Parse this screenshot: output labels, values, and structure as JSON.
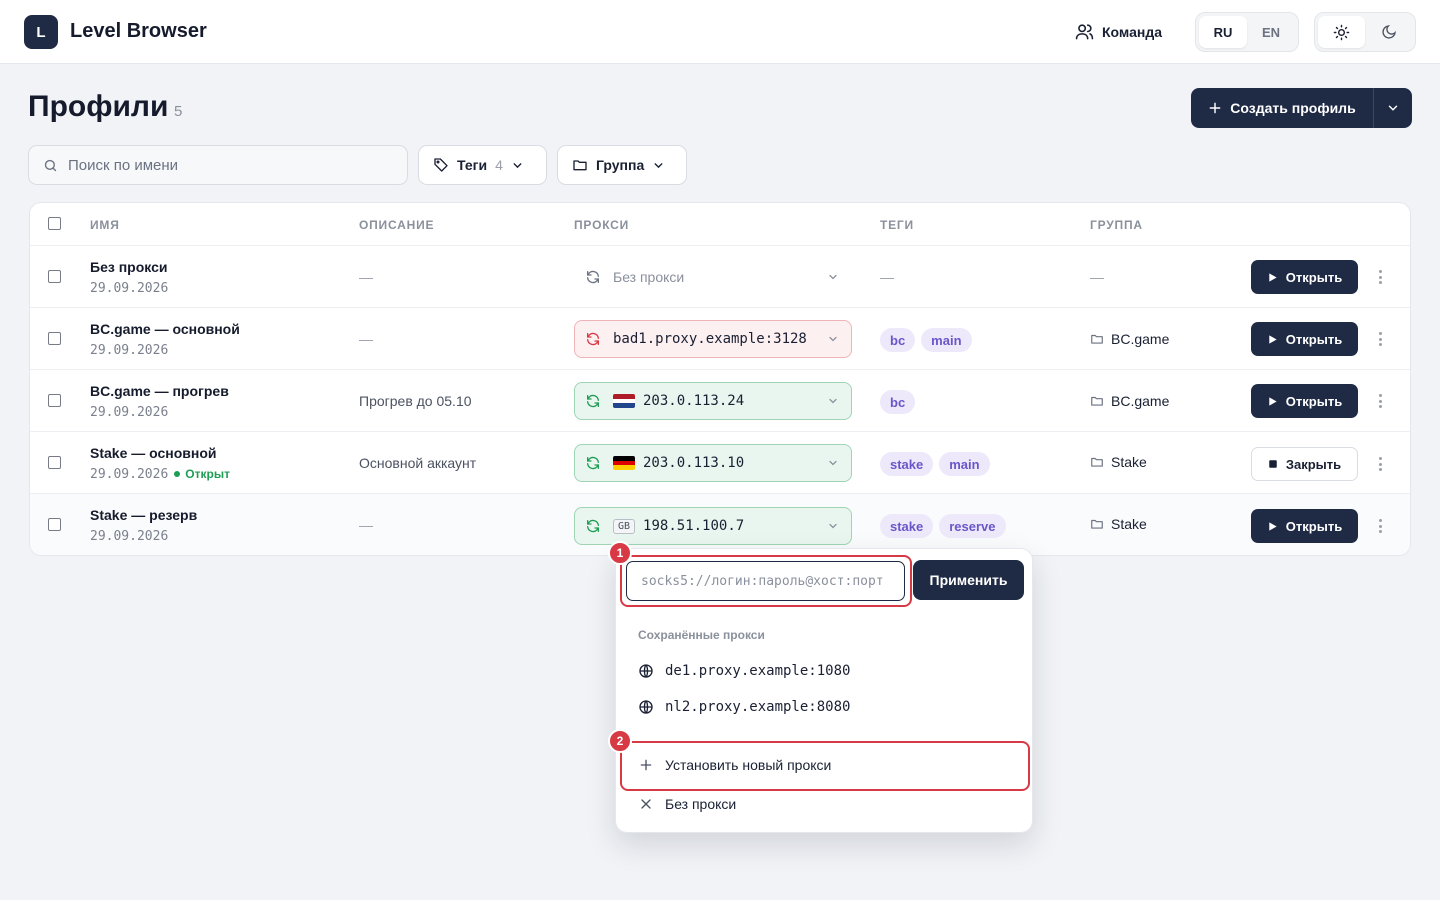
{
  "app": {
    "logo_letter": "L",
    "name": "Level Browser"
  },
  "header": {
    "team_label": "Команда",
    "langs": [
      "RU",
      "EN"
    ],
    "active_lang": "RU",
    "active_theme": "light"
  },
  "page": {
    "title": "Профили",
    "count": "5",
    "create_label": "Создать профиль"
  },
  "filters": {
    "search_placeholder": "Поиск по имени",
    "tags_label": "Теги",
    "tags_count": "4",
    "group_label": "Группа"
  },
  "table": {
    "columns": [
      "ИМЯ",
      "ОПИСАНИЕ",
      "ПРОКСИ",
      "ТЕГИ",
      "ГРУППА"
    ],
    "rows": [
      {
        "name": "Без прокси",
        "date": "29.09.2026",
        "status": "",
        "description": "—",
        "proxy": "Без прокси",
        "proxy_state": "none",
        "tags": [],
        "tags_empty": "—",
        "group": "—",
        "action": "Открыть"
      },
      {
        "name": "BC.game — основной",
        "date": "29.09.2026",
        "status": "",
        "description": "—",
        "proxy": "bad1.proxy.example:3128",
        "proxy_state": "bad",
        "tags": [
          "bc",
          "main"
        ],
        "group": "BC.game",
        "action": "Открыть"
      },
      {
        "name": "BC.game — прогрев",
        "date": "29.09.2026",
        "status": "",
        "description": "Прогрев до 05.10",
        "proxy": "203.0.113.24",
        "proxy_state": "ok",
        "proxy_country": "NL",
        "tags": [
          "bc"
        ],
        "group": "BC.game",
        "action": "Открыть"
      },
      {
        "name": "Stake — основной",
        "date": "29.09.2026",
        "status": "Открыт",
        "description": "Основной аккаунт",
        "proxy": "203.0.113.10",
        "proxy_state": "ok",
        "proxy_country": "DE",
        "tags": [
          "stake",
          "main"
        ],
        "group": "Stake",
        "action": "Закрыть"
      },
      {
        "name": "Stake — резерв",
        "date": "29.09.2026",
        "status": "",
        "description": "—",
        "proxy": "198.51.100.7",
        "proxy_state": "ok",
        "proxy_country": "GB",
        "tags": [
          "stake",
          "reserve"
        ],
        "group": "Stake",
        "action": "Открыть"
      }
    ]
  },
  "proxy_menu": {
    "input_placeholder": "socks5://логин:пароль@хост:порт",
    "apply_label": "Применить",
    "saved_title": "Сохранённые прокси",
    "saved": [
      "de1.proxy.example:1080",
      "nl2.proxy.example:8080"
    ],
    "new_label": "Установить новый прокси",
    "none_label": "Без прокси",
    "markers": [
      "1",
      "2"
    ]
  },
  "colors": {
    "primary": "#1f2a44",
    "accent_red": "#d83a45",
    "ok_green": "#1f9d55",
    "tag_purple": "#6b56c9"
  }
}
